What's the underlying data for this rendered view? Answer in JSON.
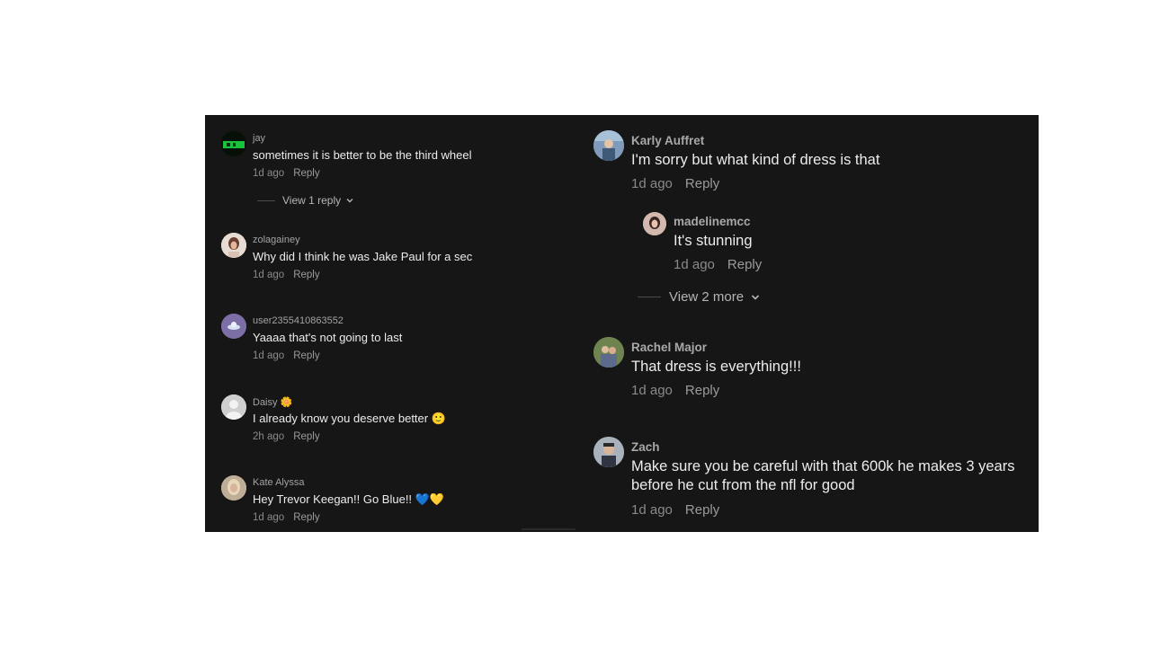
{
  "left_comments": [
    {
      "username": "jay",
      "text": "sometimes it is better to be the third wheel",
      "time": "1d ago",
      "reply": "Reply",
      "view_replies": "View 1 reply"
    },
    {
      "username": "zolagainey",
      "text": "Why did I think he was Jake Paul for a sec",
      "time": "1d ago",
      "reply": "Reply"
    },
    {
      "username": "user2355410863552",
      "text": "Yaaaa that's not going to last",
      "time": "1d ago",
      "reply": "Reply"
    },
    {
      "username": "Daisy 🌼",
      "text": "I already know you deserve better 🙂",
      "time": "2h ago",
      "reply": "Reply"
    },
    {
      "username": "Kate Alyssa",
      "text": "Hey Trevor Keegan!! Go Blue!! 💙💛",
      "time": "1d ago",
      "reply": "Reply"
    }
  ],
  "right_comments": [
    {
      "username": "Karly Auffret",
      "text": "I'm sorry but what kind of dress is that",
      "time": "1d ago",
      "reply": "Reply",
      "sub_reply": {
        "username": "madelinemcc",
        "text": "It's stunning",
        "time": "1d ago",
        "reply": "Reply"
      },
      "view_more": "View 2 more"
    },
    {
      "username": "Rachel Major",
      "text": "That dress is everything!!!",
      "time": "1d ago",
      "reply": "Reply"
    },
    {
      "username": "Zach",
      "text_line1": "Make sure you be careful with that 600k he makes 3 years",
      "text_line2": "before he cut from the nfl for good",
      "time": "1d ago",
      "reply": "Reply"
    }
  ],
  "icons": {
    "chevron": "chevron-down-icon"
  },
  "colors": {
    "background": "#161616",
    "text": "#ececec",
    "muted": "#8a8a8a"
  }
}
